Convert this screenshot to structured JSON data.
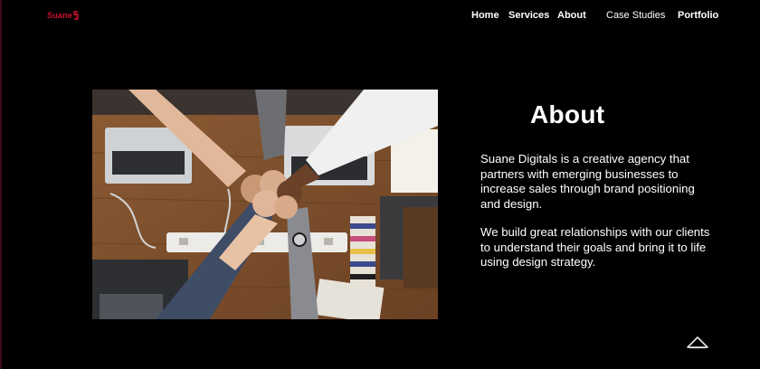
{
  "brand": {
    "name": "Suane",
    "accent": "#c8102e"
  },
  "nav": {
    "items": [
      "Home",
      "Services",
      "About",
      "Case Studies",
      "Portfolio"
    ]
  },
  "about": {
    "title": "About",
    "paragraphs": [
      "Suane Digitals is a creative agency that partners with emerging businesses to increase sales through brand positioning and design.",
      "We build great relationships with our clients to understand their goals and bring it to life using design strategy."
    ],
    "image_icon": "team-fist-bump-photo"
  },
  "controls": {
    "scroll_top_icon": "chevron-up-icon"
  }
}
